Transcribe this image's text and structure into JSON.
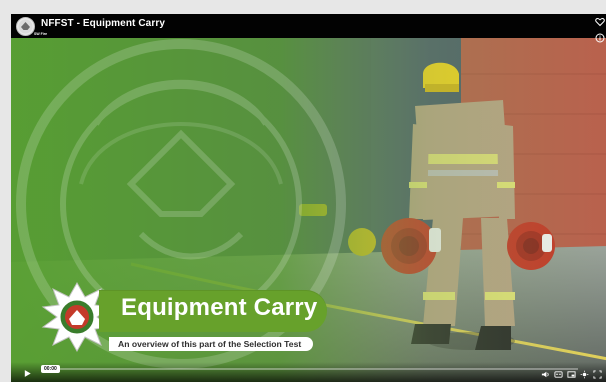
{
  "video": {
    "title": "NFFST - Equipment Carry",
    "channel_label": "SW Fire",
    "current_time": "00:00",
    "progress": 0.02
  },
  "lower_third": {
    "title": "Equipment Carry",
    "subtitle": "An overview of this part of the Selection Test"
  },
  "icons": {
    "top_right": [
      "heart-icon",
      "info-icon"
    ],
    "controls_right": [
      "volume-icon",
      "captions-icon",
      "pip-icon",
      "settings-icon",
      "fullscreen-icon"
    ],
    "play": "play-icon"
  },
  "colors": {
    "banner_green": "#67a12b",
    "topbar_bg": "#000000",
    "text_white": "#ffffff"
  }
}
